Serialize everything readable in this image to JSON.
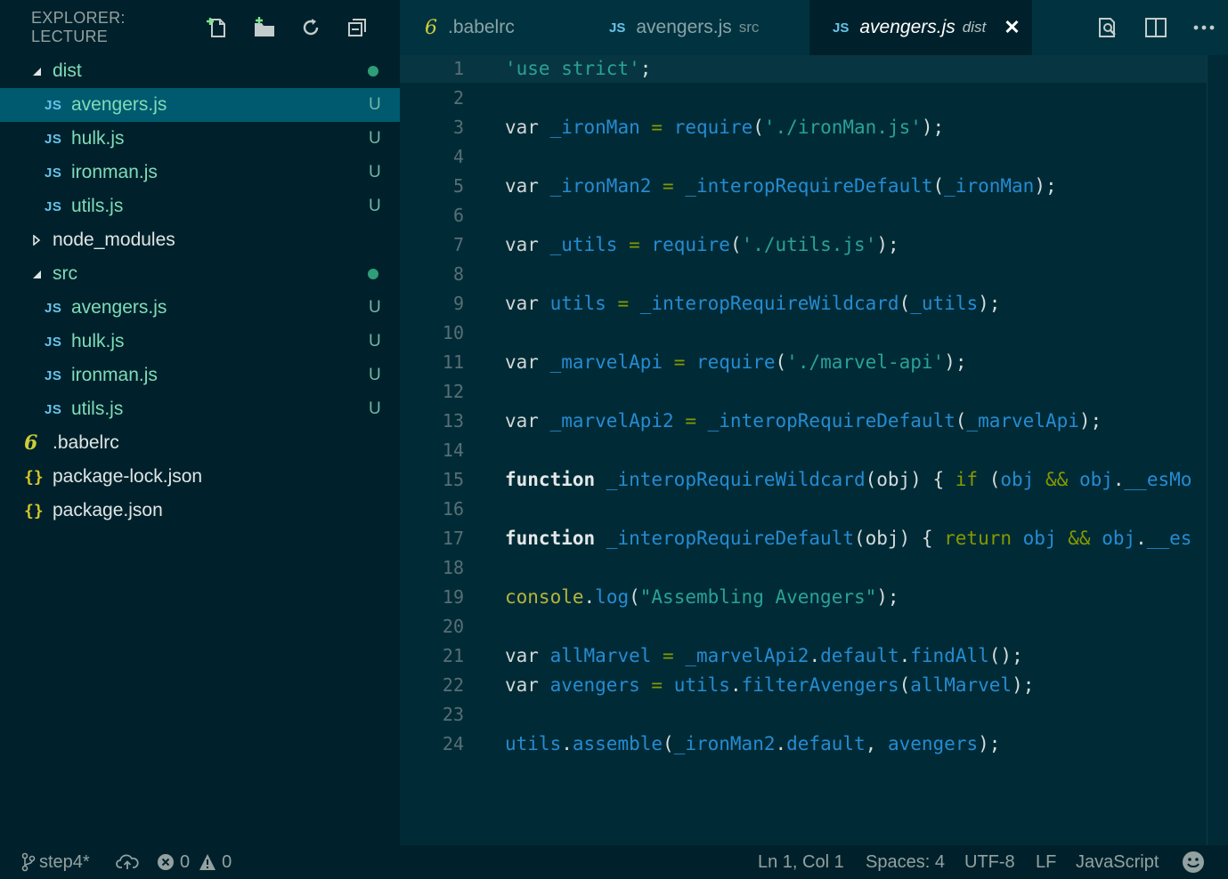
{
  "sidebar": {
    "title": "EXPLORER: LECTURE",
    "tree": [
      {
        "label": "dist",
        "kind": "folder",
        "expanded": true,
        "status": "dot"
      },
      {
        "label": "avengers.js",
        "kind": "js",
        "status": "U",
        "selected": true
      },
      {
        "label": "hulk.js",
        "kind": "js",
        "status": "U"
      },
      {
        "label": "ironman.js",
        "kind": "js",
        "status": "U"
      },
      {
        "label": "utils.js",
        "kind": "js",
        "status": "U"
      },
      {
        "label": "node_modules",
        "kind": "folder",
        "expanded": false,
        "status": ""
      },
      {
        "label": "src",
        "kind": "folder",
        "expanded": true,
        "status": "dot"
      },
      {
        "label": "avengers.js",
        "kind": "js",
        "status": "U"
      },
      {
        "label": "hulk.js",
        "kind": "js",
        "status": "U"
      },
      {
        "label": "ironman.js",
        "kind": "js",
        "status": "U"
      },
      {
        "label": "utils.js",
        "kind": "js",
        "status": "U"
      },
      {
        "label": ".babelrc",
        "kind": "babel",
        "status": ""
      },
      {
        "label": "package-lock.json",
        "kind": "json",
        "status": ""
      },
      {
        "label": "package.json",
        "kind": "json",
        "status": ""
      }
    ],
    "js_badge": "JS",
    "json_badge": "{}",
    "babel_badge": "6"
  },
  "tabs": [
    {
      "name": ".babelrc",
      "desc": "",
      "icon": "babel"
    },
    {
      "name": "avengers.js",
      "desc": "src",
      "icon": "js"
    },
    {
      "name": "avengers.js",
      "desc": "dist",
      "icon": "js",
      "active": true
    }
  ],
  "editor": {
    "lines": [
      "'use strict';",
      "",
      "var _ironMan = require('./ironMan.js');",
      "",
      "var _ironMan2 = _interopRequireDefault(_ironMan);",
      "",
      "var _utils = require('./utils.js');",
      "",
      "var utils = _interopRequireWildcard(_utils);",
      "",
      "var _marvelApi = require('./marvel-api');",
      "",
      "var _marvelApi2 = _interopRequireDefault(_marvelApi);",
      "",
      "function _interopRequireWildcard(obj) { if (obj && obj.__esMo",
      "",
      "function _interopRequireDefault(obj) { return obj && obj.__es",
      "",
      "console.log(\"Assembling Avengers\");",
      "",
      "var allMarvel = _marvelApi2.default.findAll();",
      "var avengers = utils.filterAvengers(allMarvel);",
      "",
      "utils.assemble(_ironMan2.default, avengers);"
    ]
  },
  "statusbar": {
    "branch": "step4*",
    "errors": "0",
    "warnings": "0",
    "position": "Ln 1, Col 1",
    "spaces": "Spaces: 4",
    "encoding": "UTF-8",
    "eol": "LF",
    "language": "JavaScript"
  },
  "colors": {
    "sidebar_bg": "#00212b",
    "editor_bg": "#002b36",
    "selection": "#005a6f",
    "keyword_green": "#859900",
    "identifier_blue": "#268bd2",
    "string_cyan": "#2aa198"
  }
}
